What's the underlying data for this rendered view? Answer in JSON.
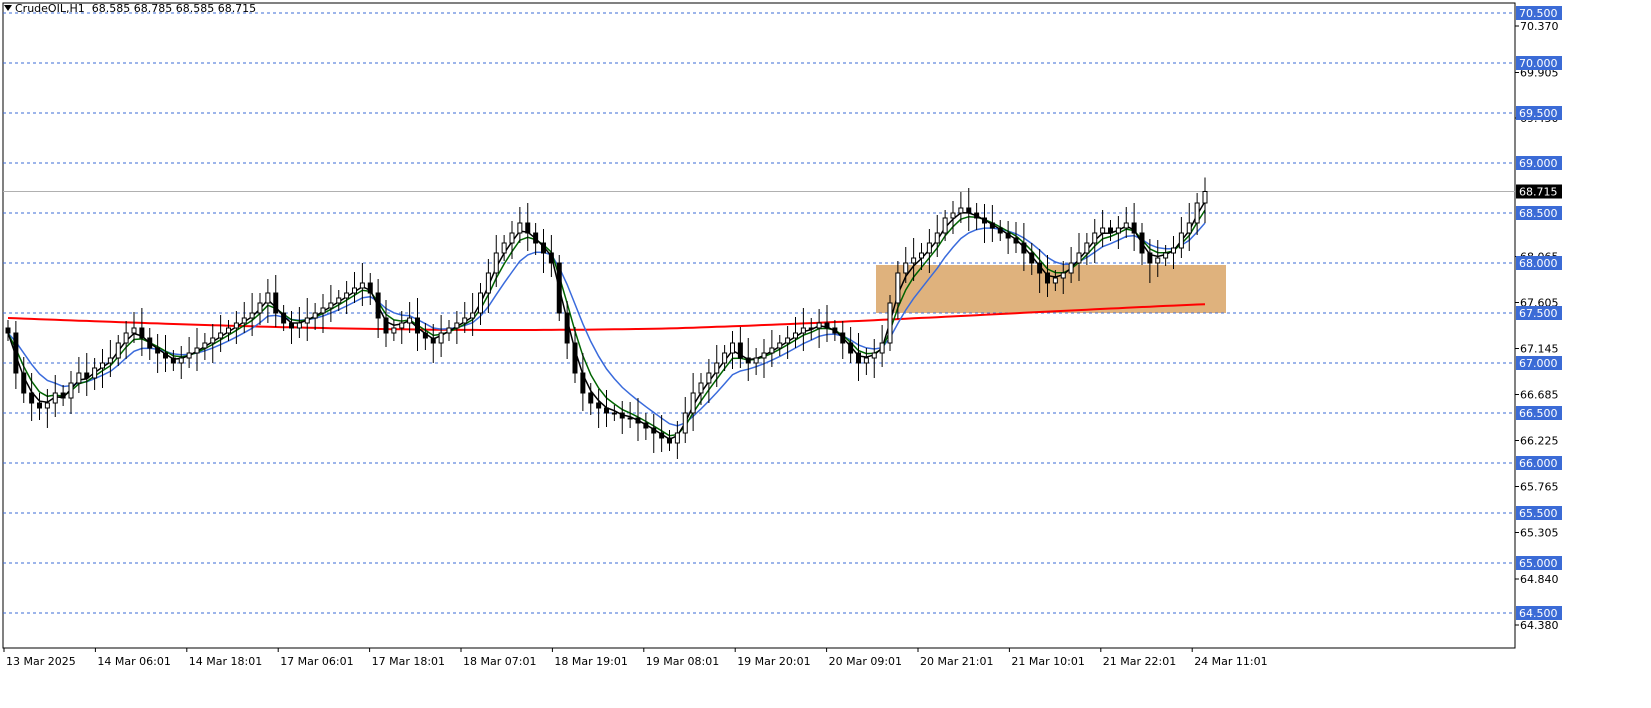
{
  "header": {
    "symbol": "CrudeOIL,H1",
    "ohlc": "68.585 68.785 68.585 68.715"
  },
  "colors": {
    "grid": "#3b6bd6",
    "bull": "#000000",
    "bear": "#000000",
    "ema_fast": "#000000",
    "ema_mid": "#006400",
    "ema_slow": "#3a6bdc",
    "ema_long": "#ff0000",
    "zone": "#d9a566",
    "current_price_bg": "#000000",
    "label_bg": "#3b6bd6"
  },
  "chart_data": {
    "type": "candlestick",
    "ylim": [
      64.15,
      70.6
    ],
    "grid_on": true,
    "price_levels": [
      "70.500",
      "70.000",
      "69.500",
      "69.000",
      "68.500",
      "68.000",
      "67.500",
      "67.000",
      "66.500",
      "66.000",
      "65.500",
      "65.000",
      "64.500"
    ],
    "scale_ticks": [
      "70.370",
      "69.905",
      "69.450",
      "68.065",
      "67.605",
      "67.145",
      "66.685",
      "66.225",
      "65.765",
      "65.305",
      "64.840",
      "64.380"
    ],
    "current_price": "68.715",
    "time_labels": [
      "13 Mar 2025",
      "14 Mar 06:01",
      "14 Mar 18:01",
      "17 Mar 06:01",
      "17 Mar 18:01",
      "18 Mar 07:01",
      "18 Mar 19:01",
      "19 Mar 08:01",
      "19 Mar 20:01",
      "20 Mar 09:01",
      "20 Mar 21:01",
      "21 Mar 10:01",
      "21 Mar 22:01",
      "24 Mar 11:01"
    ],
    "zone": {
      "top": 67.98,
      "bottom": 67.5,
      "x_from_label": "20 Mar 09:01",
      "x_to_bars_after": 34
    },
    "series_close": [
      67.3,
      66.9,
      66.7,
      66.6,
      66.55,
      66.6,
      66.7,
      66.65,
      66.8,
      66.9,
      66.85,
      66.95,
      67.0,
      67.05,
      67.2,
      67.3,
      67.35,
      67.25,
      67.15,
      67.1,
      67.05,
      67.0,
      67.05,
      67.1,
      67.15,
      67.2,
      67.25,
      67.3,
      67.35,
      67.4,
      67.45,
      67.5,
      67.6,
      67.7,
      67.5,
      67.4,
      67.35,
      67.4,
      67.45,
      67.5,
      67.55,
      67.6,
      67.65,
      67.7,
      67.75,
      67.8,
      67.7,
      67.45,
      67.3,
      67.35,
      67.4,
      67.45,
      67.3,
      67.25,
      67.2,
      67.3,
      67.35,
      67.4,
      67.45,
      67.5,
      67.7,
      67.9,
      68.1,
      68.2,
      68.3,
      68.4,
      68.3,
      68.2,
      68.1,
      68.0,
      67.5,
      67.2,
      66.9,
      66.7,
      66.6,
      66.55,
      66.5,
      66.5,
      66.45,
      66.45,
      66.4,
      66.35,
      66.3,
      66.25,
      66.2,
      66.3,
      66.5,
      66.7,
      66.8,
      66.9,
      67.0,
      67.1,
      67.2,
      67.05,
      67.0,
      67.05,
      67.1,
      67.15,
      67.2,
      67.25,
      67.3,
      67.35,
      67.35,
      67.4,
      67.35,
      67.3,
      67.2,
      67.1,
      67.0,
      67.05,
      67.1,
      67.2,
      67.6,
      67.9,
      68.0,
      68.05,
      68.1,
      68.2,
      68.3,
      68.45,
      68.5,
      68.55,
      68.5,
      68.45,
      68.4,
      68.35,
      68.3,
      68.25,
      68.2,
      68.1,
      68.0,
      67.9,
      67.8,
      67.85,
      67.9,
      68.0,
      68.1,
      68.2,
      68.3,
      68.35,
      68.3,
      68.35,
      68.4,
      68.3,
      68.1,
      68.0,
      68.05,
      68.1,
      68.15,
      68.3,
      68.4,
      68.6,
      68.715
    ]
  }
}
